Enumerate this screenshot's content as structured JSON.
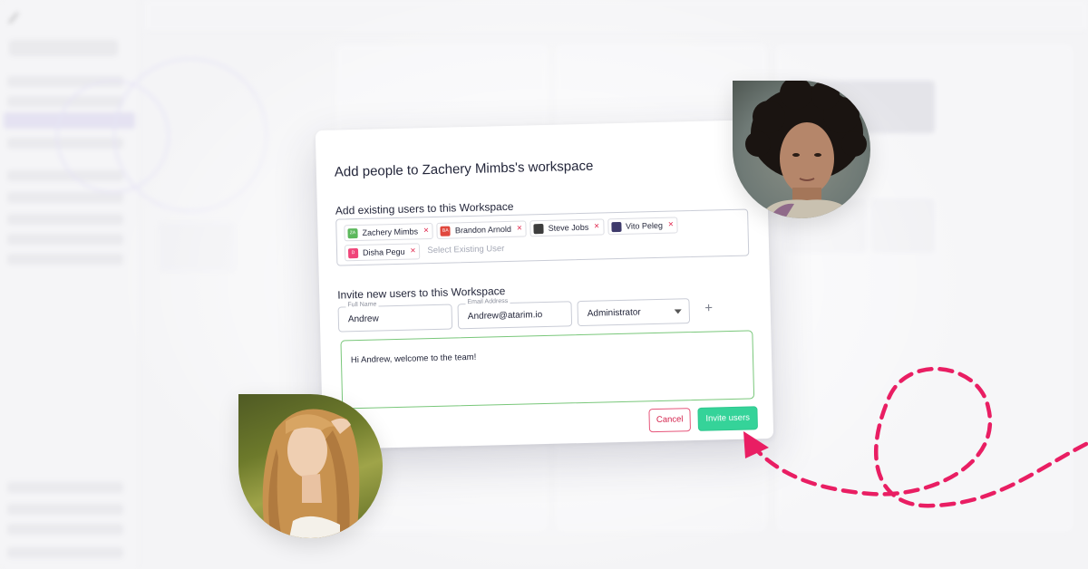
{
  "dialog": {
    "title": "Add people to Zachery Mimbs's workspace",
    "existing_label": "Add existing users to this Workspace",
    "tags": [
      {
        "name": "Zachery Mimbs",
        "initials": "ZA",
        "color": "#5cb85c"
      },
      {
        "name": "Brandon Arnold",
        "initials": "BA",
        "color": "#e0483e"
      },
      {
        "name": "Steve Jobs",
        "initials": "",
        "color": "#3d3d3d"
      },
      {
        "name": "Vito Peleg",
        "initials": "",
        "color": "#3e3a6b"
      },
      {
        "name": "Disha Pegu",
        "initials": "D",
        "color": "#f0457a"
      }
    ],
    "tag_remove_glyph": "×",
    "tags_placeholder": "Select Existing User",
    "invite_label": "Invite new users to this Workspace",
    "full_name": {
      "label": "Full Name",
      "value": "Andrew"
    },
    "email": {
      "label": "Email Address",
      "value": "Andrew@atarim.io"
    },
    "role": {
      "value": "Administrator"
    },
    "add_glyph": "+",
    "message": "Hi Andrew, welcome to the team!",
    "cancel_label": "Cancel",
    "invite_button_label": "Invite users"
  },
  "colors": {
    "accent_green": "#35d399",
    "danger_pink": "#e0244b",
    "message_border": "#79c77a",
    "arrow_pink": "#e91e63"
  },
  "icons": {
    "remove": "close-icon",
    "add": "plus-icon",
    "dropdown": "chevron-down-icon"
  }
}
